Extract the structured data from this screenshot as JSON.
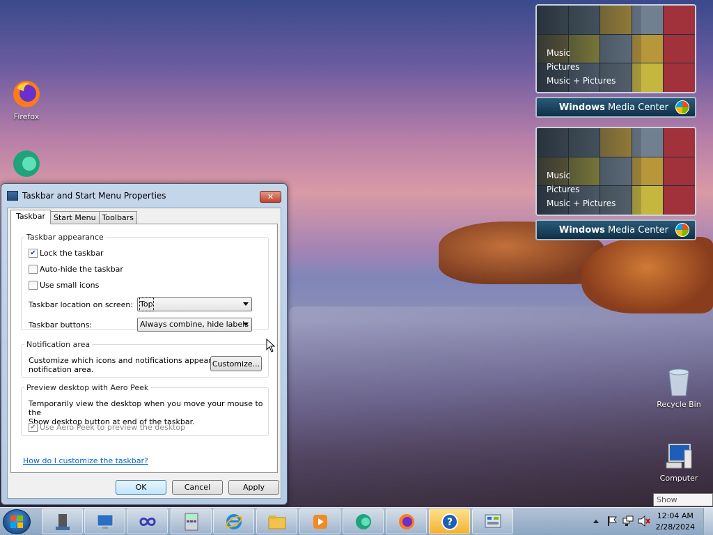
{
  "desktop": {
    "icons": [
      {
        "label": "Firefox",
        "icon": "firefox-icon"
      },
      {
        "label": "",
        "icon": "edge-icon"
      },
      {
        "label": "Recycle Bin",
        "icon": "recycle-bin-icon"
      },
      {
        "label": "Computer",
        "icon": "computer-icon"
      }
    ]
  },
  "media_center": {
    "gadgets": [
      {
        "menu": [
          "Music",
          "Pictures",
          "Music + Pictures"
        ],
        "brand_a": "Windows",
        "brand_b": " Media Center"
      },
      {
        "menu": [
          "Music",
          "Pictures",
          "Music + Pictures"
        ],
        "brand_a": "Windows",
        "brand_b": " Media Center"
      }
    ]
  },
  "dialog": {
    "title": "Taskbar and Start Menu Properties",
    "close_label": "✕",
    "tabs": [
      "Taskbar",
      "Start Menu",
      "Toolbars"
    ],
    "appearance": {
      "legend": "Taskbar appearance",
      "lock": {
        "label": "Lock the taskbar",
        "checked": true
      },
      "autohide": {
        "label": "Auto-hide the taskbar",
        "checked": false
      },
      "small_icons": {
        "label": "Use small icons",
        "checked": false
      },
      "location_label": "Taskbar location on screen:",
      "location_value": "Top",
      "buttons_label": "Taskbar buttons:",
      "buttons_value": "Always combine, hide labels"
    },
    "notification": {
      "legend": "Notification area",
      "desc_1": "Customize which icons and notifications appear in the",
      "desc_2": "notification area.",
      "customize_label": "Customize..."
    },
    "aero_peek": {
      "legend": "Preview desktop with Aero Peek",
      "desc_1": "Temporarily view the desktop when you move your mouse to the",
      "desc_2": "Show desktop button at end of the taskbar.",
      "use_label": "Use Aero Peek to preview the desktop",
      "checked": true
    },
    "help_link": "How do I customize the taskbar?",
    "ok_label": "OK",
    "cancel_label": "Cancel",
    "apply_label": "Apply"
  },
  "taskbar": {
    "start_icon": "windows-logo-icon",
    "pinned": [
      "taskbar-properties-icon",
      "remote-desktop-icon",
      "infinity-app-icon",
      "calculator-icon",
      "internet-explorer-icon",
      "file-explorer-icon",
      "media-player-icon",
      "edge-icon",
      "firefox-icon",
      "help-icon",
      "control-panel-icon"
    ],
    "time": "12:04 AM",
    "date": "2/28/2024",
    "tooltip": "Show desktop"
  }
}
